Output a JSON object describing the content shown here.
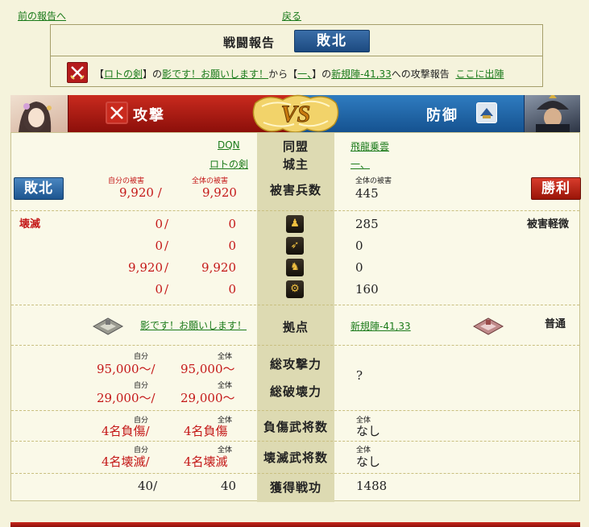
{
  "nav": {
    "prev": "前の報告へ",
    "back": "戻る"
  },
  "report": {
    "title": "戦闘報告",
    "result": "敗北",
    "line": {
      "bracket_open": "【",
      "attacker_city": "ロトの剣",
      "bracket_close": "】の",
      "attacker_base": "影です！お願いします！",
      "from": "から【",
      "defender_name": "一、",
      "to_mid": "】の",
      "defender_base": "新規陣-41,33",
      "suffix": "への攻撃報告",
      "sortie": "ここに出陣"
    }
  },
  "banner": {
    "attack": "攻撃",
    "defense": "防御",
    "vs": "VS"
  },
  "table": {
    "alliance_label": "同盟",
    "lord_label": "城主",
    "atk_alliance": "DQN",
    "atk_lord": "ロトの剣",
    "def_alliance": "飛龍乗雲",
    "def_lord": "一、",
    "atk_result": "敗北",
    "def_result": "勝利",
    "casualty_label": "被害兵数",
    "own_damage_label": "自分の被害",
    "all_damage_label": "全体の被害",
    "def_all_damage_label": "全体の被害",
    "atk_own_total": "9,920",
    "atk_all_total": "9,920",
    "def_total": "445",
    "slash": "/",
    "atk_status": "壊滅",
    "def_status": "被害軽微",
    "units": [
      {
        "icon": "spear-icon",
        "own": "0",
        "all": "0",
        "def": "285"
      },
      {
        "icon": "bow-icon",
        "own": "0",
        "all": "0",
        "def": "0"
      },
      {
        "icon": "horse-icon",
        "own": "9,920",
        "all": "9,920",
        "def": "0"
      },
      {
        "icon": "siege-icon",
        "own": "0",
        "all": "0",
        "def": "160"
      }
    ],
    "base_label": "拠点",
    "atk_base": "影です！お願いします！",
    "def_base": "新規陣-41,33",
    "def_base_type": "普通",
    "self_label": "自分",
    "all_label": "全体",
    "attack_power_label": "総攻撃力",
    "destroy_power_label": "総破壊力",
    "atk_power_own": "95,000～",
    "atk_power_all": "95,000～",
    "destroy_power_own": "29,000～",
    "destroy_power_all": "29,000～",
    "def_power": "?",
    "injured_label": "負傷武将数",
    "atk_injured_own": "4名負傷",
    "atk_injured_all": "4名負傷",
    "def_injured": "なし",
    "destroyed_label": "壊滅武将数",
    "atk_destroyed_own": "4名壊滅",
    "atk_destroyed_all": "4名壊滅",
    "def_destroyed": "なし",
    "merit_label": "獲得戦功",
    "atk_merit_own": "40",
    "atk_merit_all": "40",
    "def_merit": "1488"
  },
  "colors": {
    "lose_blue": "#1d5590",
    "win_red": "#9a1508",
    "attack_red": "#c92a1e",
    "defense_blue": "#2f7cc0",
    "link_green": "#1a7a1a",
    "damage_red": "#c41818"
  }
}
